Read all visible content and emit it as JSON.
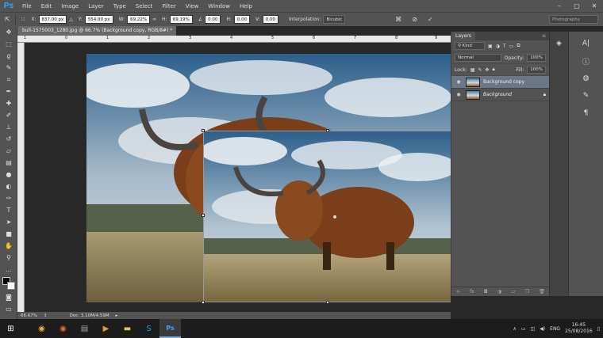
{
  "app": {
    "logo": "Ps"
  },
  "menu": [
    "File",
    "Edit",
    "Image",
    "Layer",
    "Type",
    "Select",
    "Filter",
    "View",
    "Window",
    "Help"
  ],
  "window_controls": [
    "–",
    "▢",
    "✕"
  ],
  "options": {
    "x_label": "X:",
    "x_value": "837.00 px",
    "y_label": "Y:",
    "y_value": "554.00 px",
    "w_label": "W:",
    "w_value": "69.22%",
    "h_label": "H:",
    "h_value": "69.19%",
    "rot_value": "0.00",
    "hskew_label": "H:",
    "hskew_value": "0.00",
    "vskew_label": "V:",
    "vskew_value": "0.00",
    "interp_label": "Interpolation:",
    "interp_value": "Bicubic",
    "workspace": "Photography"
  },
  "document": {
    "tab_title": "bull-1575003_1280.jpg @ 66.7% (Background copy, RGB/8#) *",
    "close": "×"
  },
  "ruler": [
    "1",
    "0",
    "1",
    "2",
    "3",
    "4",
    "5",
    "6",
    "7",
    "8",
    "9",
    "10"
  ],
  "status": {
    "zoom": "66.67%",
    "doc": "Doc: 3.10M/4.59M"
  },
  "layers_panel": {
    "tab": "Layers",
    "kind": "Kind",
    "blend_mode": "Normal",
    "opacity_label": "Opacity:",
    "opacity_value": "100%",
    "lock_label": "Lock:",
    "fill_label": "Fill:",
    "fill_value": "100%",
    "layers": [
      {
        "name": "Background copy",
        "selected": true
      },
      {
        "name": "Background",
        "selected": false
      }
    ]
  },
  "taskbar": {
    "lang": "ENG",
    "time": "16:45",
    "date": "25/08/2016"
  }
}
